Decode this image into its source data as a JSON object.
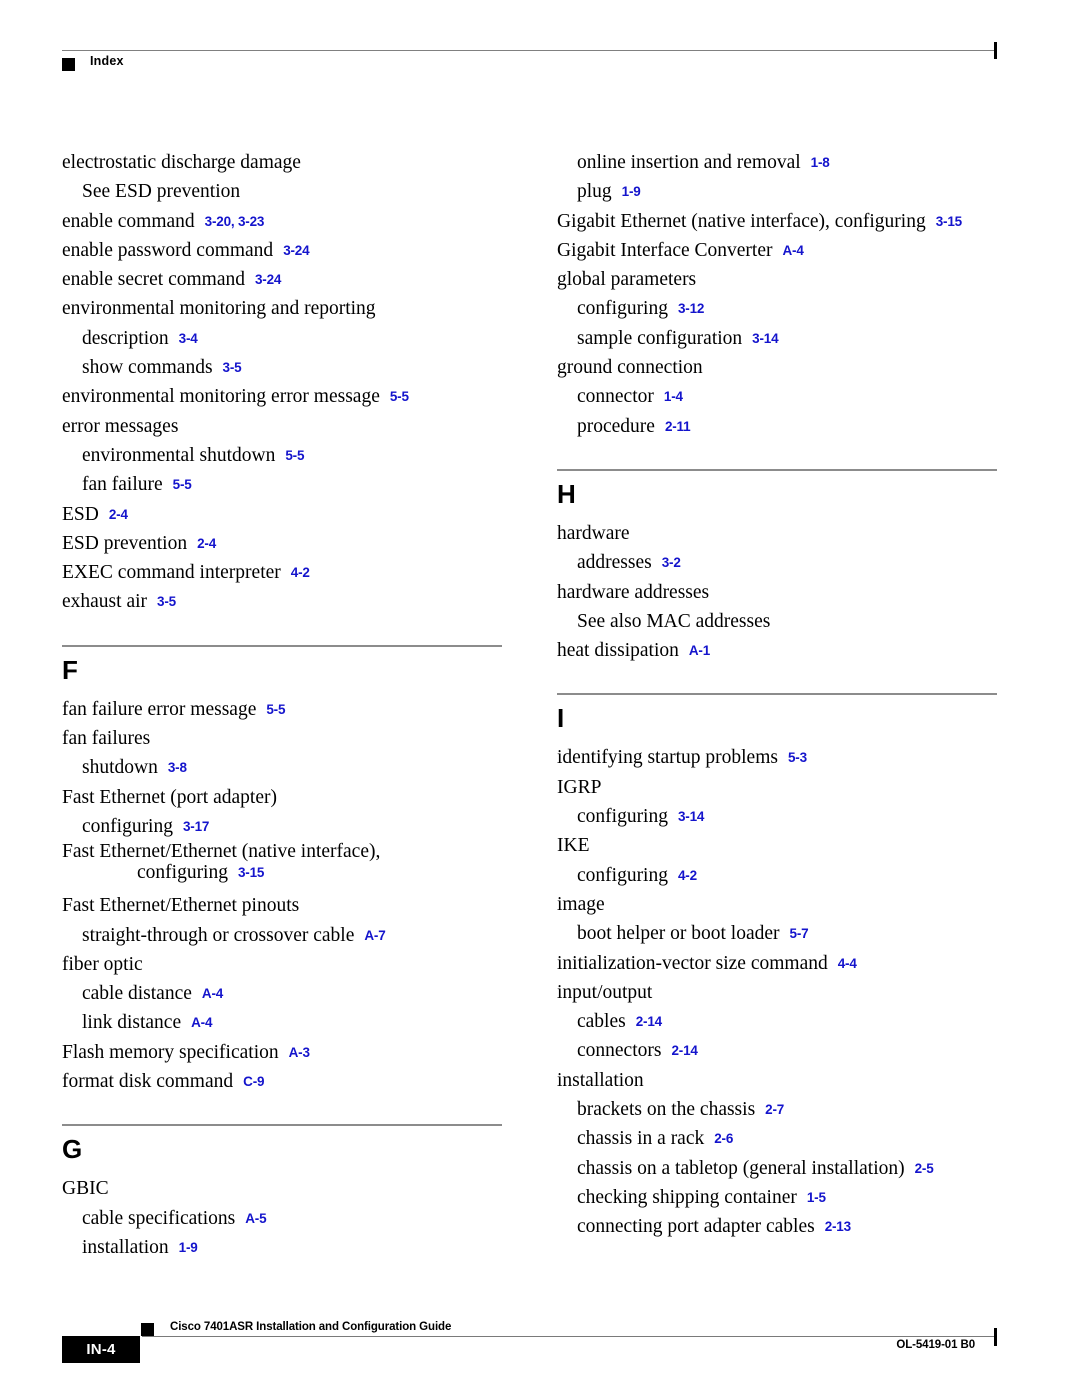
{
  "header": {
    "title": "Index",
    "marker": "black-square-marker"
  },
  "colors": {
    "page_reference_blue": "#1414CC",
    "rule_gray": "#808080",
    "text_black": "#000000"
  },
  "columns": {
    "left": {
      "blocks": [
        {
          "type": "entries",
          "entries": [
            {
              "level": 1,
              "text": "electrostatic discharge damage",
              "refs": []
            },
            {
              "level": 2,
              "text": "See ESD prevention",
              "refs": []
            },
            {
              "level": 1,
              "text": "enable command",
              "refs": [
                "3-20, 3-23"
              ]
            },
            {
              "level": 1,
              "text": "enable password command",
              "refs": [
                "3-24"
              ]
            },
            {
              "level": 1,
              "text": "enable secret command",
              "refs": [
                "3-24"
              ]
            },
            {
              "level": 1,
              "text": "environmental monitoring and reporting",
              "refs": []
            },
            {
              "level": 2,
              "text": "description",
              "refs": [
                "3-4"
              ]
            },
            {
              "level": 2,
              "text": "show commands",
              "refs": [
                "3-5"
              ]
            },
            {
              "level": 1,
              "text": "environmental monitoring error message",
              "refs": [
                "5-5"
              ]
            },
            {
              "level": 1,
              "text": "error messages",
              "refs": []
            },
            {
              "level": 2,
              "text": "environmental shutdown",
              "refs": [
                "5-5"
              ]
            },
            {
              "level": 2,
              "text": "fan failure",
              "refs": [
                "5-5"
              ]
            },
            {
              "level": 1,
              "text": "ESD",
              "refs": [
                "2-4"
              ]
            },
            {
              "level": 1,
              "text": "ESD prevention",
              "refs": [
                "2-4"
              ]
            },
            {
              "level": 1,
              "text": "EXEC command interpreter",
              "refs": [
                "4-2"
              ]
            },
            {
              "level": 1,
              "text": "exhaust air",
              "refs": [
                "3-5"
              ]
            }
          ]
        },
        {
          "type": "section",
          "letter": "F",
          "entries": [
            {
              "level": 1,
              "text": "fan failure error message",
              "refs": [
                "5-5"
              ]
            },
            {
              "level": 1,
              "text": "fan failures",
              "refs": []
            },
            {
              "level": 2,
              "text": "shutdown",
              "refs": [
                "3-8"
              ]
            },
            {
              "level": 1,
              "text": "Fast Ethernet (port adapter)",
              "refs": []
            },
            {
              "level": 2,
              "text": "configuring",
              "refs": [
                "3-17"
              ]
            },
            {
              "level": 1,
              "wrapped": true,
              "text": "Fast Ethernet/Ethernet (native interface),",
              "continuation": "configuring",
              "refs": [
                "3-15"
              ]
            },
            {
              "level": 1,
              "text": "Fast Ethernet/Ethernet pinouts",
              "refs": []
            },
            {
              "level": 2,
              "text": "straight-through or crossover cable",
              "refs": [
                "A-7"
              ]
            },
            {
              "level": 1,
              "text": "fiber optic",
              "refs": []
            },
            {
              "level": 2,
              "text": "cable distance",
              "refs": [
                "A-4"
              ]
            },
            {
              "level": 2,
              "text": "link distance",
              "refs": [
                "A-4"
              ]
            },
            {
              "level": 1,
              "text": "Flash memory specification",
              "refs": [
                "A-3"
              ]
            },
            {
              "level": 1,
              "text": "format disk command",
              "refs": [
                "C-9"
              ]
            }
          ]
        },
        {
          "type": "section",
          "letter": "G",
          "entries": [
            {
              "level": 1,
              "text": "GBIC",
              "refs": []
            },
            {
              "level": 2,
              "text": "cable specifications",
              "refs": [
                "A-5"
              ]
            },
            {
              "level": 2,
              "text": "installation",
              "refs": [
                "1-9"
              ]
            }
          ]
        }
      ]
    },
    "right": {
      "blocks": [
        {
          "type": "entries",
          "entries": [
            {
              "level": 2,
              "text": "online insertion and removal",
              "refs": [
                "1-8"
              ]
            },
            {
              "level": 2,
              "text": "plug",
              "refs": [
                "1-9"
              ]
            },
            {
              "level": 1,
              "text": "Gigabit Ethernet (native interface), configuring",
              "refs": [
                "3-15"
              ]
            },
            {
              "level": 1,
              "text": "Gigabit Interface Converter",
              "refs": [
                "A-4"
              ]
            },
            {
              "level": 1,
              "text": "global parameters",
              "refs": []
            },
            {
              "level": 2,
              "text": "configuring",
              "refs": [
                "3-12"
              ]
            },
            {
              "level": 2,
              "text": "sample configuration",
              "refs": [
                "3-14"
              ]
            },
            {
              "level": 1,
              "text": "ground connection",
              "refs": []
            },
            {
              "level": 2,
              "text": "connector",
              "refs": [
                "1-4"
              ]
            },
            {
              "level": 2,
              "text": "procedure",
              "refs": [
                "2-11"
              ]
            }
          ]
        },
        {
          "type": "section",
          "letter": "H",
          "entries": [
            {
              "level": 1,
              "text": "hardware",
              "refs": []
            },
            {
              "level": 2,
              "text": "addresses",
              "refs": [
                "3-2"
              ]
            },
            {
              "level": 1,
              "text": "hardware addresses",
              "refs": []
            },
            {
              "level": 2,
              "text": "See also MAC addresses",
              "refs": []
            },
            {
              "level": 1,
              "text": "heat dissipation",
              "refs": [
                "A-1"
              ]
            }
          ]
        },
        {
          "type": "section",
          "letter": "I",
          "entries": [
            {
              "level": 1,
              "text": "identifying startup problems",
              "refs": [
                "5-3"
              ]
            },
            {
              "level": 1,
              "text": "IGRP",
              "refs": []
            },
            {
              "level": 2,
              "text": "configuring",
              "refs": [
                "3-14"
              ]
            },
            {
              "level": 1,
              "text": "IKE",
              "refs": []
            },
            {
              "level": 2,
              "text": "configuring",
              "refs": [
                "4-2"
              ]
            },
            {
              "level": 1,
              "text": "image",
              "refs": []
            },
            {
              "level": 2,
              "text": "boot helper or boot loader",
              "refs": [
                "5-7"
              ]
            },
            {
              "level": 1,
              "text": "initialization-vector size command",
              "refs": [
                "4-4"
              ]
            },
            {
              "level": 1,
              "text": "input/output",
              "refs": []
            },
            {
              "level": 2,
              "text": "cables",
              "refs": [
                "2-14"
              ]
            },
            {
              "level": 2,
              "text": "connectors",
              "refs": [
                "2-14"
              ]
            },
            {
              "level": 1,
              "text": "installation",
              "refs": []
            },
            {
              "level": 2,
              "text": "brackets on the chassis",
              "refs": [
                "2-7"
              ]
            },
            {
              "level": 2,
              "text": "chassis in a rack",
              "refs": [
                "2-6"
              ]
            },
            {
              "level": 2,
              "text": "chassis on a tabletop (general installation)",
              "refs": [
                "2-5"
              ]
            },
            {
              "level": 2,
              "text": "checking shipping container",
              "refs": [
                "1-5"
              ]
            },
            {
              "level": 2,
              "text": "connecting port adapter cables",
              "refs": [
                "2-13"
              ]
            }
          ]
        }
      ]
    }
  },
  "footer": {
    "page_number": "IN-4",
    "guide_title": "Cisco 7401ASR Installation and Configuration Guide",
    "document_id": "OL-5419-01 B0",
    "marker": "black-square-marker"
  }
}
